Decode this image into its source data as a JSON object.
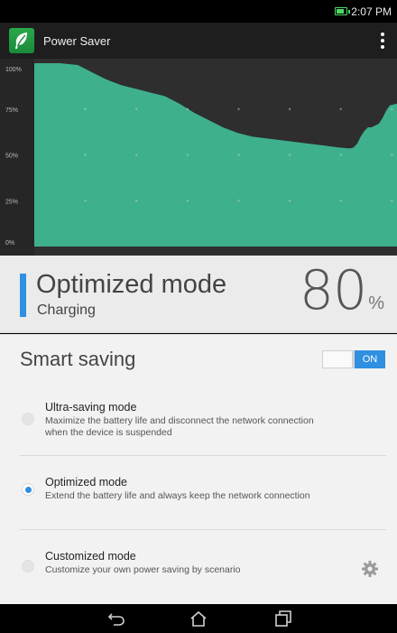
{
  "status_bar": {
    "time": "2:07 PM"
  },
  "app_bar": {
    "title": "Power Saver"
  },
  "chart_data": {
    "type": "area",
    "title": "",
    "xlabel": "",
    "ylabel": "",
    "y_tick_labels": [
      "100%",
      "75%",
      "50%",
      "25%",
      "0%"
    ],
    "ylim": [
      0,
      100
    ],
    "xlim": [
      0,
      100
    ],
    "grid": true,
    "fill_color": "#3fb08e",
    "series": [
      {
        "x": [
          0,
          7,
          12,
          16,
          20,
          24,
          28,
          32,
          36,
          40,
          44,
          48,
          52,
          56,
          60,
          64,
          68,
          72,
          76,
          80,
          84,
          87,
          88,
          89,
          90,
          91,
          92,
          93,
          94,
          95,
          96,
          97,
          98,
          100
        ],
        "values": [
          100,
          100,
          99,
          95,
          91,
          88,
          86,
          84,
          82,
          78,
          73,
          69,
          65,
          62,
          60,
          59,
          58,
          57,
          56,
          55,
          54,
          53.5,
          54,
          56,
          60,
          63,
          65,
          65,
          66,
          67,
          70,
          74,
          77,
          78
        ]
      }
    ]
  },
  "mode_panel": {
    "mode_name": "Optimized mode",
    "status": "Charging",
    "battery_level": "80",
    "percent_sign": "%"
  },
  "smart_saving": {
    "title": "Smart saving",
    "toggle_label": "ON"
  },
  "options": [
    {
      "label": "Ultra-saving mode",
      "desc_line1": "Maximize the battery life and disconnect the network connection",
      "desc_line2": "when the device is suspended",
      "selected": false
    },
    {
      "label": "Optimized mode",
      "desc_line1": "Extend the battery life and always keep the network connection",
      "selected": true
    },
    {
      "label": "Customized mode",
      "desc_line1": "Customize your own power saving by scenario",
      "selected": false
    }
  ],
  "colors": {
    "accent": "#2f8fe0",
    "chart_fill": "#3fb08e",
    "chart_bg": "#2e2e2e",
    "logo_green": "#2aa84a"
  },
  "icons": {
    "battery": "battery-charging-icon",
    "overflow": "overflow-menu-icon",
    "gear": "gear-icon",
    "back": "back-icon",
    "home": "home-icon",
    "recents": "recents-icon"
  }
}
